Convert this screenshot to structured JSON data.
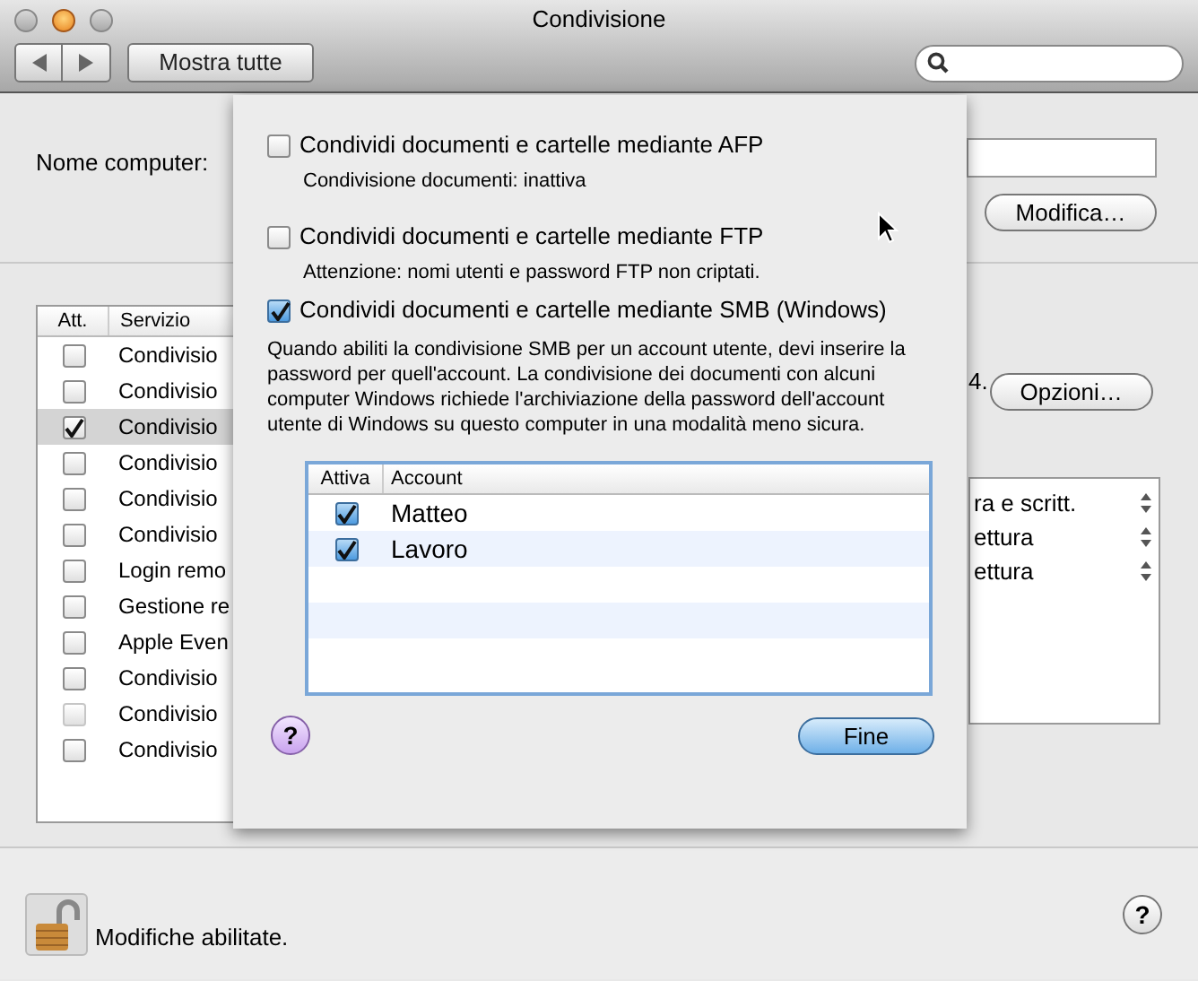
{
  "window": {
    "title": "Condivisione"
  },
  "toolbar": {
    "show_all": "Mostra tutte"
  },
  "computer_name": {
    "label": "Nome computer:",
    "edit_button": "Modifica…"
  },
  "services": {
    "columns": [
      "Att.",
      "Servizio"
    ],
    "rows": [
      {
        "name": "Condivisio",
        "checked": false,
        "selected": false,
        "disabled": false
      },
      {
        "name": "Condivisio",
        "checked": false,
        "selected": false,
        "disabled": false
      },
      {
        "name": "Condivisio",
        "checked": true,
        "selected": true,
        "disabled": false
      },
      {
        "name": "Condivisio",
        "checked": false,
        "selected": false,
        "disabled": false
      },
      {
        "name": "Condivisio",
        "checked": false,
        "selected": false,
        "disabled": false
      },
      {
        "name": "Condivisio",
        "checked": false,
        "selected": false,
        "disabled": false
      },
      {
        "name": "Login remo",
        "checked": false,
        "selected": false,
        "disabled": false
      },
      {
        "name": "Gestione re",
        "checked": false,
        "selected": false,
        "disabled": false
      },
      {
        "name": "Apple Even",
        "checked": false,
        "selected": false,
        "disabled": false
      },
      {
        "name": "Condivisio",
        "checked": false,
        "selected": false,
        "disabled": false
      },
      {
        "name": "Condivisio",
        "checked": false,
        "selected": false,
        "disabled": true
      },
      {
        "name": "Condivisio",
        "checked": false,
        "selected": false,
        "disabled": false
      }
    ]
  },
  "status_fragment": "4.",
  "options_button": "Opzioni…",
  "permissions": [
    {
      "text": "ra e scritt."
    },
    {
      "text": "ettura"
    },
    {
      "text": "ettura"
    }
  ],
  "sheet": {
    "options": [
      {
        "label": "Condividi documenti e cartelle mediante AFP",
        "checked": false,
        "note": "Condivisione documenti: inattiva"
      },
      {
        "label": "Condividi documenti e cartelle mediante FTP",
        "checked": false,
        "note": "Attenzione: nomi utenti e password FTP non criptati."
      },
      {
        "label": "Condividi documenti e cartelle mediante SMB (Windows)",
        "checked": true,
        "note": "Quando abiliti la condivisione SMB per un account utente, devi inserire la password per quell'account. La condivisione dei documenti con alcuni computer Windows richiede l'archiviazione della password dell'account utente di Windows su questo computer in una modalità meno sicura."
      }
    ],
    "accounts": {
      "columns": [
        "Attiva",
        "Account"
      ],
      "rows": [
        {
          "name": "Matteo",
          "active": true
        },
        {
          "name": "Lavoro",
          "active": true
        }
      ]
    },
    "help": "?",
    "done_button": "Fine"
  },
  "footer": {
    "lock_label": "Modifiche abilitate.",
    "locked": false,
    "help": "?"
  }
}
